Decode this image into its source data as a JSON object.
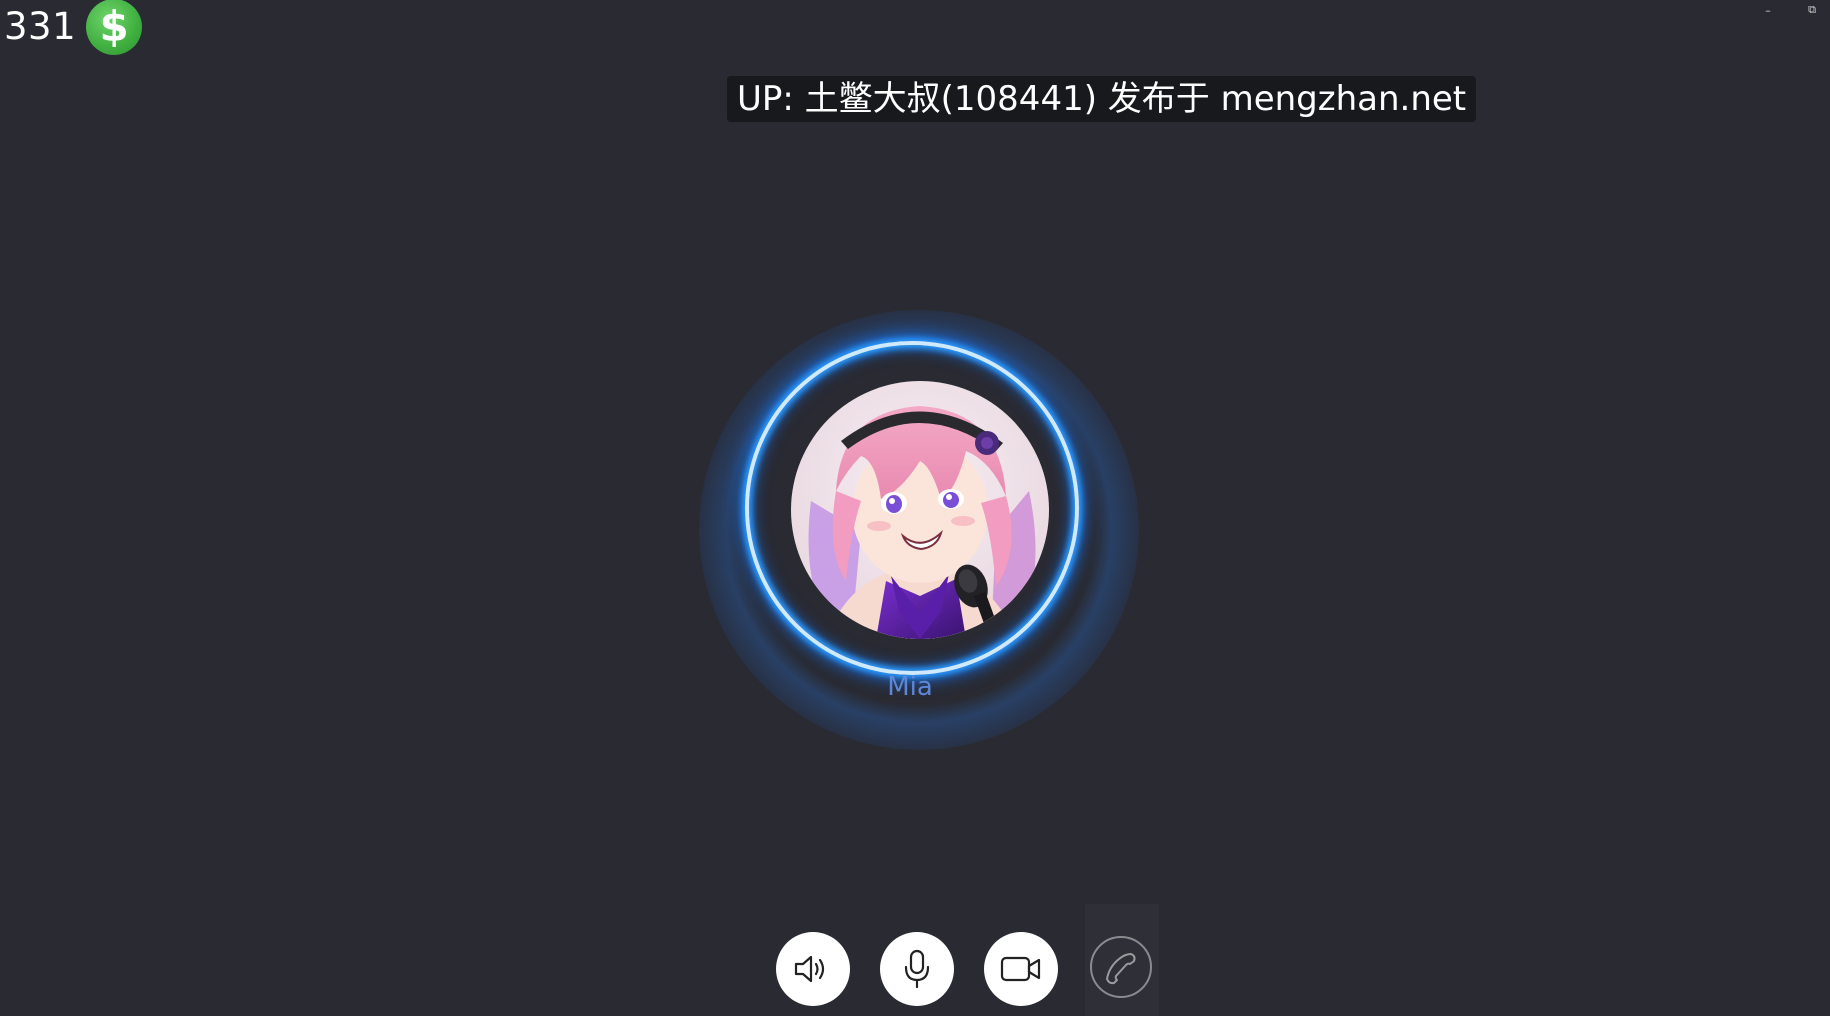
{
  "hud": {
    "coins": "331",
    "coin_icon": "dollar-coin-icon",
    "coin_symbol": "$",
    "coin_color": "#3fae3f"
  },
  "window": {
    "minimize_symbol": "–",
    "restore_symbol": "⧉"
  },
  "watermark": {
    "text": "UP: 土鳖大叔(108441) 发布于 mengzhan.net"
  },
  "call": {
    "caller_name": "Mia",
    "ring_color": "#2b9bff",
    "avatar_icon": "caller-portrait"
  },
  "controls": {
    "speaker_icon": "speaker-icon",
    "mic_icon": "microphone-icon",
    "video_icon": "video-camera-icon",
    "hangup_icon": "phone-handset-icon"
  }
}
